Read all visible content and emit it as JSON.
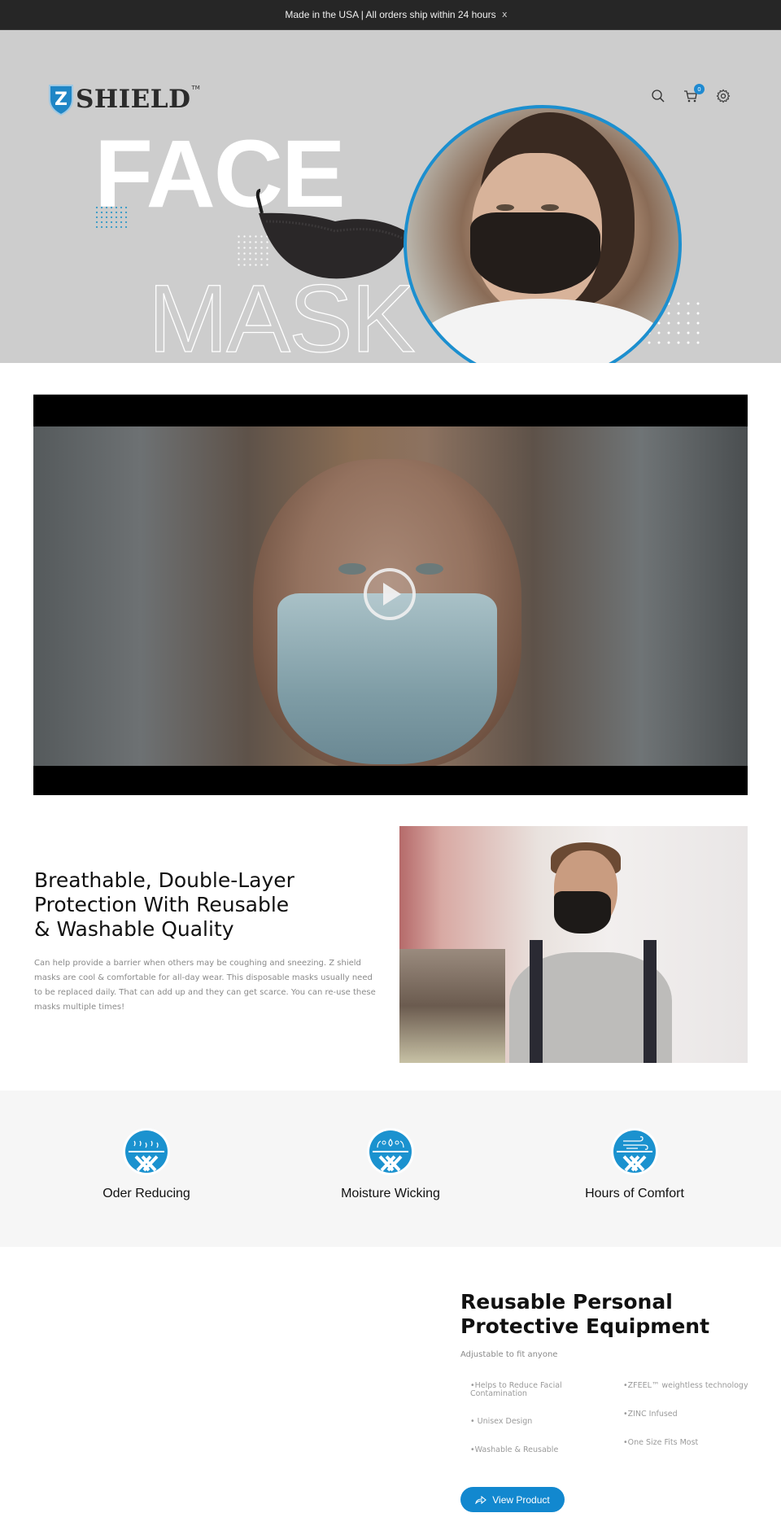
{
  "announcement": {
    "text": "Made in the USA | All orders ship within 24 hours",
    "close_label": "x"
  },
  "header": {
    "logo_letter": "Z",
    "logo_word": "SHIELD",
    "logo_tm": "TM",
    "icons": [
      "search-icon",
      "cart-icon",
      "gear-icon"
    ],
    "cart_count": "0"
  },
  "hero": {
    "headline_top": "FACE",
    "headline_bottom": "MASK",
    "slides_total": 1,
    "slide_active": 1,
    "accent_color": "#1c8fcf"
  },
  "video": {
    "play_icon": "play-icon"
  },
  "feature": {
    "title_lines": [
      "Breathable, Double-Layer",
      "Protection With Reusable",
      "& Washable Quality"
    ],
    "body": "Can help provide a barrier when others may be coughing and sneezing. Z shield masks are cool & comfortable for all-day wear. This disposable masks usually need to be replaced daily. That can add up and they can get scarce. You can re-use these masks multiple times!"
  },
  "benefits": [
    {
      "icon": "odor-icon",
      "label": "Oder Reducing"
    },
    {
      "icon": "moisture-icon",
      "label": "Moisture Wicking"
    },
    {
      "icon": "airflow-icon",
      "label": "Hours of Comfort"
    }
  ],
  "ppe": {
    "title_lines": [
      "Reusable Personal",
      "Protective Equipment"
    ],
    "subtitle": "Adjustable to fit anyone",
    "bullets_left": [
      "•Helps to Reduce Facial Contamination",
      "• Unisex Design",
      "•Washable & Reusable"
    ],
    "bullets_right": [
      "•ZFEEL™ weightless technology",
      "•ZINC Infused",
      "•One Size Fits Most"
    ],
    "button_label": "View Product",
    "button_color": "#1288cf"
  }
}
